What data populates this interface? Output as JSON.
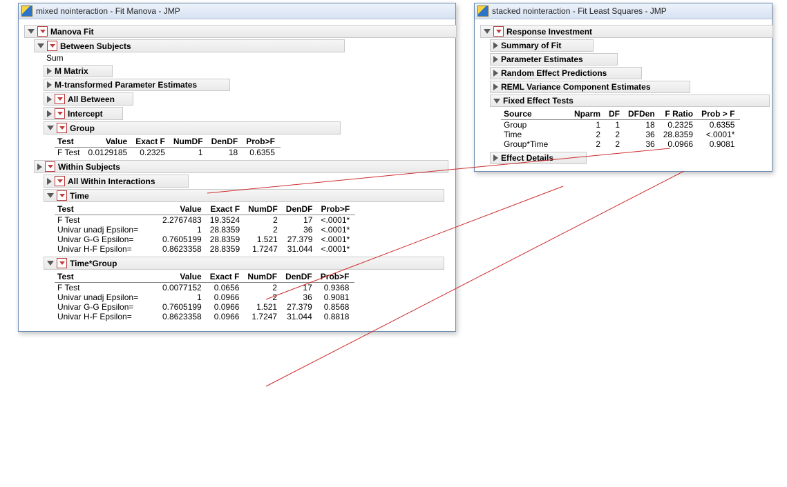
{
  "left": {
    "title": "mixed nointeraction - Fit Manova - JMP",
    "root": "Manova Fit",
    "between": {
      "title": "Between Subjects",
      "sum": "Sum",
      "m_matrix": "M Matrix",
      "m_trans": "M-transformed Parameter Estimates",
      "all_between": "All Between",
      "intercept": "Intercept",
      "group": "Group",
      "group_cols": [
        "Test",
        "Value",
        "Exact F",
        "NumDF",
        "DenDF",
        "Prob>F"
      ],
      "group_row": [
        "F Test",
        "0.0129185",
        "0.2325",
        "1",
        "18",
        "0.6355"
      ]
    },
    "within": {
      "title": "Within Subjects",
      "all_within": "All Within Interactions",
      "time": {
        "title": "Time",
        "cols": [
          "Test",
          "Value",
          "Exact F",
          "NumDF",
          "DenDF",
          "Prob>F"
        ],
        "rows": [
          [
            "F Test",
            "2.2767483",
            "19.3524",
            "2",
            "17",
            "<.0001*"
          ],
          [
            "Univar unadj Epsilon=",
            "1",
            "28.8359",
            "2",
            "36",
            "<.0001*"
          ],
          [
            "Univar G-G  Epsilon=",
            "0.7605199",
            "28.8359",
            "1.521",
            "27.379",
            "<.0001*"
          ],
          [
            "Univar H-F  Epsilon=",
            "0.8623358",
            "28.8359",
            "1.7247",
            "31.044",
            "<.0001*"
          ]
        ]
      },
      "timegroup": {
        "title": "Time*Group",
        "cols": [
          "Test",
          "Value",
          "Exact F",
          "NumDF",
          "DenDF",
          "Prob>F"
        ],
        "rows": [
          [
            "F Test",
            "0.0077152",
            "0.0656",
            "2",
            "17",
            "0.9368"
          ],
          [
            "Univar unadj Epsilon=",
            "1",
            "0.0966",
            "2",
            "36",
            "0.9081"
          ],
          [
            "Univar G-G  Epsilon=",
            "0.7605199",
            "0.0966",
            "1.521",
            "27.379",
            "0.8568"
          ],
          [
            "Univar H-F  Epsilon=",
            "0.8623358",
            "0.0966",
            "1.7247",
            "31.044",
            "0.8818"
          ]
        ]
      }
    }
  },
  "right": {
    "title": "stacked  nointeraction - Fit Least Squares - JMP",
    "root": "Response Investment",
    "sections": {
      "summary": "Summary of Fit",
      "param": "Parameter Estimates",
      "random": "Random Effect Predictions",
      "reml": "REML Variance Component Estimates",
      "fixed": "Fixed Effect Tests",
      "effect_details": "Effect Details"
    },
    "fixed_cols": [
      "Source",
      "Nparm",
      "DF",
      "DFDen",
      "F Ratio",
      "Prob > F"
    ],
    "fixed_rows": [
      [
        "Group",
        "1",
        "1",
        "18",
        "0.2325",
        "0.6355"
      ],
      [
        "Time",
        "2",
        "2",
        "36",
        "28.8359",
        "<.0001*"
      ],
      [
        "Group*Time",
        "2",
        "2",
        "36",
        "0.0966",
        "0.9081"
      ]
    ]
  }
}
